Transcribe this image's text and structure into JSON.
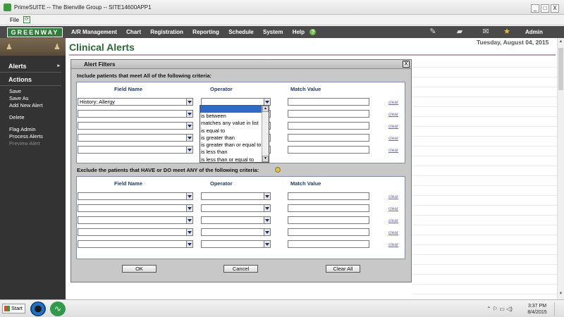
{
  "window": {
    "title": "PrimeSUITE -- The Bienville Group -- SITE14600APP1",
    "minimize": "_",
    "maximize": "□",
    "close": "X"
  },
  "menu": {
    "file": "File",
    "refresh_glyph": "⟳"
  },
  "header": {
    "logo": "GREENWAY",
    "nav": [
      "A/R Management",
      "Chart",
      "Registration",
      "Reporting",
      "Schedule",
      "System",
      "Help"
    ],
    "help_glyph": "?",
    "user": "Admin"
  },
  "sidebar": {
    "alerts_label": "Alerts",
    "actions_label": "Actions",
    "actions": [
      "Save",
      "Save As",
      "Add New Alert"
    ],
    "delete": "Delete",
    "more": [
      "Flag Admin",
      "Process Alerts"
    ],
    "disabled": [
      "Preview Alert"
    ]
  },
  "page": {
    "title": "Clinical Alerts",
    "date": "Tuesday, August 04, 2015"
  },
  "dialog": {
    "title": "Alert Filters",
    "close_glyph": "X",
    "include_label": "Include patients that meet All of the following criteria:",
    "exclude_label": "Exclude the patients that HAVE or DO meet ANY of the following criteria:",
    "columns": {
      "field": "Field Name",
      "operator": "Operator",
      "match": "Match Value"
    },
    "clear": "clear",
    "include_rows": [
      {
        "field": "History: Allergy",
        "operator": ""
      },
      {
        "field": "",
        "operator": ""
      },
      {
        "field": "",
        "operator": ""
      },
      {
        "field": "",
        "operator": ""
      },
      {
        "field": "",
        "operator": ""
      }
    ],
    "exclude_rows": [
      {
        "field": "",
        "operator": ""
      },
      {
        "field": "",
        "operator": ""
      },
      {
        "field": "",
        "operator": ""
      },
      {
        "field": "",
        "operator": ""
      },
      {
        "field": "",
        "operator": ""
      }
    ],
    "operator_options": [
      "is between",
      "matches any value in list",
      "is equal to",
      "is greater than",
      "is greater than or equal to",
      "is less than",
      "is less than or equal to"
    ],
    "buttons": {
      "ok": "OK",
      "cancel": "Cancel",
      "clear_all": "Clear All"
    }
  },
  "taskbar": {
    "start": "Start",
    "tray": "⌃  ⚐  ▭  ◁)",
    "time": "3:37 PM",
    "date": "8/4/2015"
  }
}
